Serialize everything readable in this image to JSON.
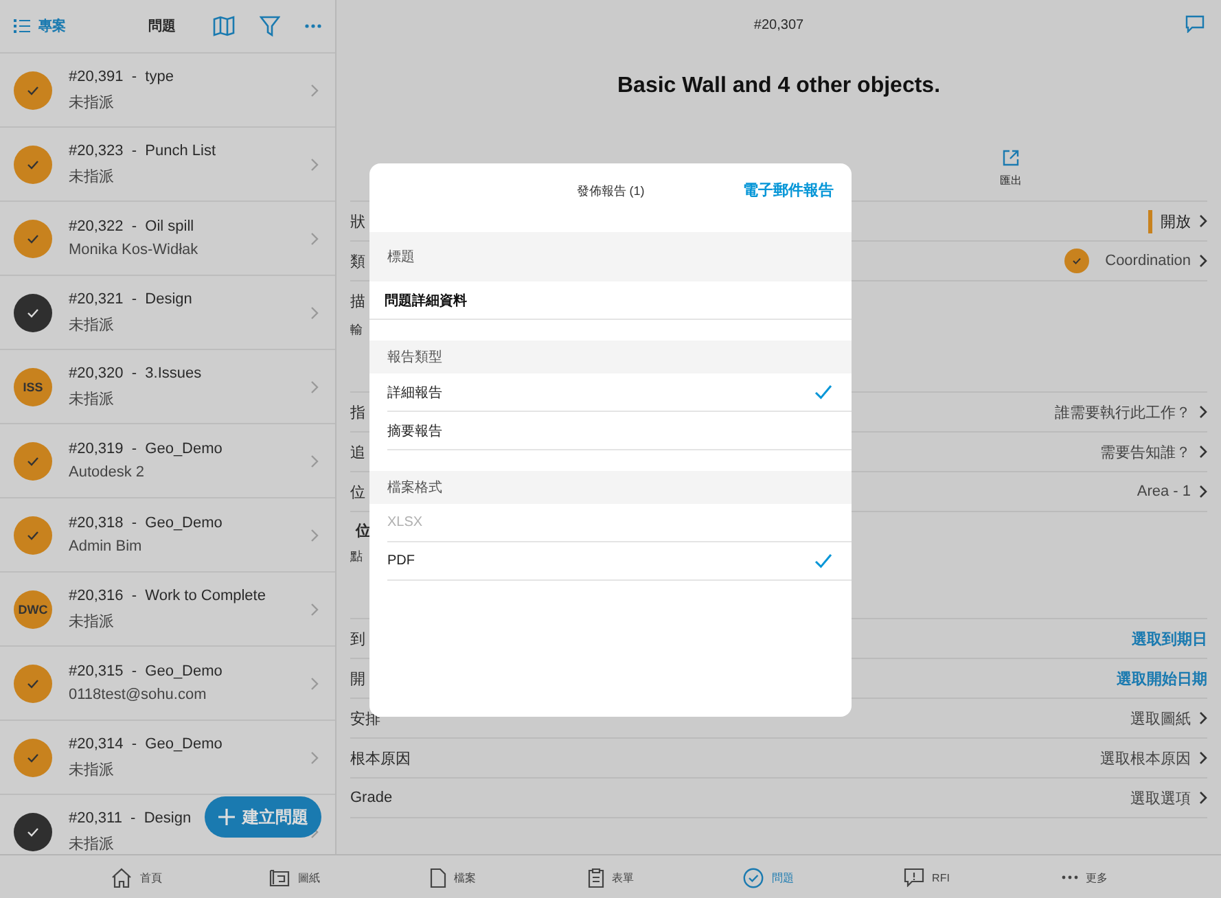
{
  "sidebar": {
    "projects_link": "專案",
    "title": "問題",
    "items": [
      {
        "title": "#20,391  -  type",
        "subtitle": "未指派",
        "badge": {
          "kind": "check",
          "color": "#c8821e"
        }
      },
      {
        "title": "#20,323  -  Punch List",
        "subtitle": "未指派",
        "badge": {
          "kind": "check",
          "color": "#c8821e"
        }
      },
      {
        "title": "#20,322  -  Oil spill",
        "subtitle": "Monika Kos-Widłak",
        "badge": {
          "kind": "check",
          "color": "#c8821e"
        }
      },
      {
        "title": "#20,321  -  Design",
        "subtitle": "未指派",
        "badge": {
          "kind": "check",
          "color": "#2f2f2f"
        }
      },
      {
        "title": "#20,320  -  3.Issues",
        "subtitle": "未指派",
        "badge": {
          "kind": "text",
          "text": "ISS",
          "color": "#c8821e"
        }
      },
      {
        "title": "#20,319  -  Geo_Demo",
        "subtitle": "Autodesk 2",
        "badge": {
          "kind": "check",
          "color": "#c8821e"
        }
      },
      {
        "title": "#20,318  -  Geo_Demo",
        "subtitle": "Admin Bim",
        "badge": {
          "kind": "check",
          "color": "#c8821e"
        }
      },
      {
        "title": "#20,316  -  Work to Complete",
        "subtitle": "未指派",
        "badge": {
          "kind": "text",
          "text": "DWC",
          "color": "#c8821e"
        }
      },
      {
        "title": "#20,315  -  Geo_Demo",
        "subtitle": "0118test@sohu.com",
        "badge": {
          "kind": "check",
          "color": "#c8821e"
        }
      },
      {
        "title": "#20,314  -  Geo_Demo",
        "subtitle": "未指派",
        "badge": {
          "kind": "check",
          "color": "#c8821e"
        }
      },
      {
        "title": "#20,311  -  Design",
        "subtitle": "未指派",
        "badge": {
          "kind": "check",
          "color": "#2f2f2f"
        }
      }
    ],
    "create_button": "建立問題"
  },
  "detail": {
    "header_title": "#20,307",
    "heading": "Basic Wall and 4 other objects.",
    "export_label": "匯出",
    "fields": [
      {
        "kind": "status",
        "label": "狀",
        "value": "開放",
        "color": "#c8821e"
      },
      {
        "kind": "badge",
        "label": "類",
        "value": "Coordination",
        "color": "#c8821e"
      },
      {
        "kind": "label",
        "label": "描"
      },
      {
        "kind": "note",
        "label": "輸"
      },
      {
        "kind": "select",
        "label": "指",
        "value": "誰需要執行此工作？"
      },
      {
        "kind": "select",
        "label": "追",
        "value": "需要告知誰？"
      },
      {
        "kind": "select",
        "label": "位",
        "value": "Area - 1"
      },
      {
        "kind": "sublabel",
        "label": "位"
      },
      {
        "kind": "note",
        "label": "點"
      },
      {
        "kind": "link",
        "label": "到",
        "value": "選取到期日"
      },
      {
        "kind": "link",
        "label": "開",
        "value": "選取開始日期"
      },
      {
        "kind": "select",
        "label": "安排",
        "value": "選取圖紙"
      },
      {
        "kind": "select",
        "label": "根本原因",
        "value": "選取根本原因"
      },
      {
        "kind": "select",
        "label": "Grade",
        "value": "選取選項"
      }
    ]
  },
  "dialog": {
    "title": "發佈報告 (1)",
    "action": "電子郵件報告",
    "sections": [
      {
        "header": "標題",
        "rows": [
          {
            "kind": "input",
            "text": "問題詳細資料"
          }
        ]
      },
      {
        "header": "報告類型",
        "rows": [
          {
            "kind": "option",
            "text": "詳細報告",
            "selected": true,
            "disabled": false
          },
          {
            "kind": "option",
            "text": "摘要報告",
            "selected": false,
            "disabled": false
          }
        ]
      },
      {
        "header": "檔案格式",
        "rows": [
          {
            "kind": "option",
            "text": "XLSX",
            "selected": false,
            "disabled": true
          },
          {
            "kind": "option",
            "text": "PDF",
            "selected": true,
            "disabled": false
          }
        ]
      }
    ]
  },
  "tab_bar": [
    {
      "kind": "home",
      "label": "首頁",
      "selected": false
    },
    {
      "kind": "sheet",
      "label": "圖紙",
      "selected": false
    },
    {
      "kind": "file",
      "label": "檔案",
      "selected": false
    },
    {
      "kind": "clipboard",
      "label": "表單",
      "selected": false
    },
    {
      "kind": "check",
      "label": "問題",
      "selected": true
    },
    {
      "kind": "bubble",
      "label": "RFI",
      "selected": false
    },
    {
      "kind": "dots",
      "label": "更多",
      "selected": false
    }
  ]
}
